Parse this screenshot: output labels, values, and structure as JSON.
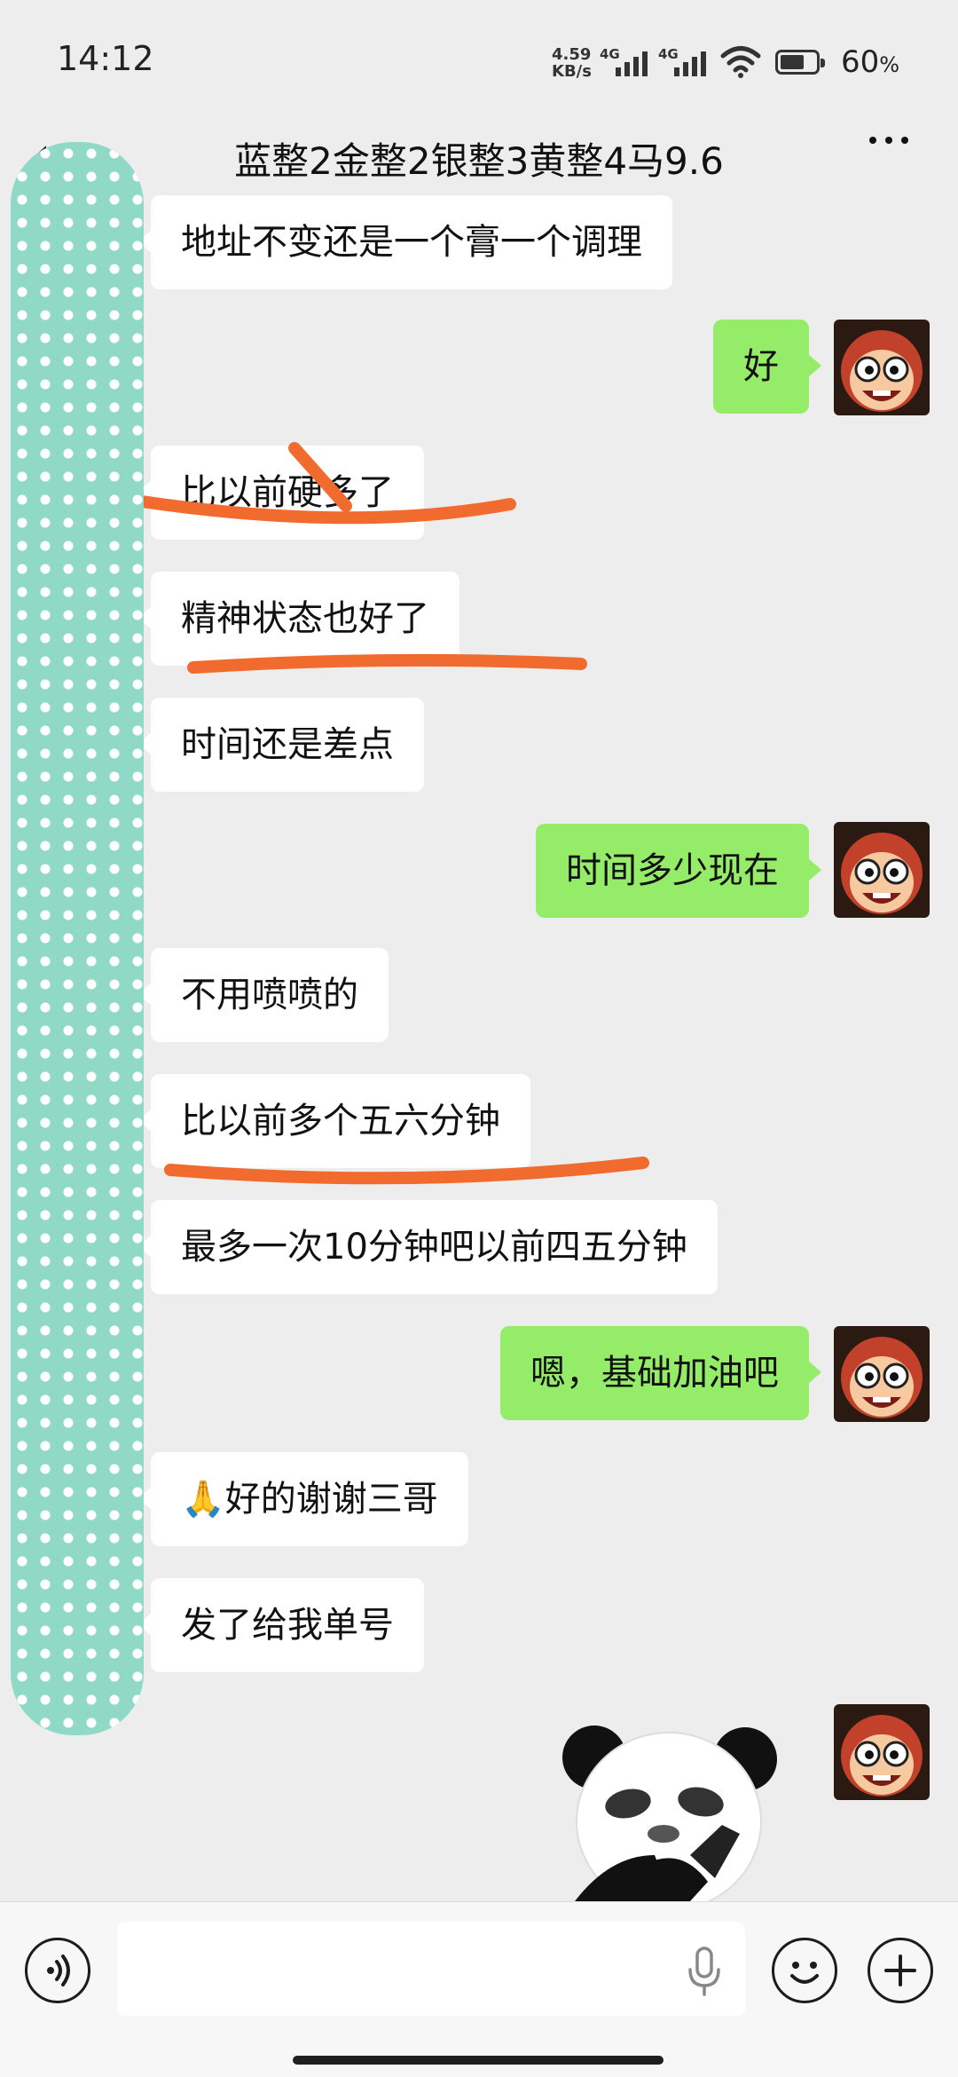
{
  "status_bar": {
    "time": "14:12",
    "net_speed_value": "4.59",
    "net_speed_unit": "KB/s",
    "signal1_label": "4G",
    "signal2_label": "4G",
    "battery_percent": "60",
    "battery_unit": "%"
  },
  "header": {
    "title": "蓝整2金整2银整3黄整4马9.6"
  },
  "messages": [
    {
      "direction": "in",
      "text": "地址不变还是一个膏一个调理"
    },
    {
      "direction": "out",
      "text": "好"
    },
    {
      "direction": "in",
      "text": "比以前硬多了"
    },
    {
      "direction": "in",
      "text": "精神状态也好了"
    },
    {
      "direction": "in",
      "text": "时间还是差点"
    },
    {
      "direction": "out",
      "text": "时间多少现在"
    },
    {
      "direction": "in",
      "text": "不用喷喷的"
    },
    {
      "direction": "in",
      "text": "比以前多个五六分钟"
    },
    {
      "direction": "in",
      "text": "最多一次10分钟吧以前四五分钟"
    },
    {
      "direction": "out",
      "text": "嗯，基础加油吧"
    },
    {
      "direction": "in",
      "text": "🙏好的谢谢三哥"
    },
    {
      "direction": "in",
      "text": "发了给我单号"
    },
    {
      "direction": "out",
      "type": "sticker",
      "text": ""
    }
  ],
  "input": {
    "value": "",
    "placeholder": ""
  },
  "colors": {
    "chat_background": "#ededed",
    "incoming_bubble": "#ffffff",
    "outgoing_bubble": "#95ec69",
    "annotation_stroke": "#f26b2e",
    "censor_fill": "#8fd9c6"
  },
  "icons": [
    "back-arrow-icon",
    "more-icon",
    "voice-icon",
    "microphone-icon",
    "emoji-icon",
    "plus-icon",
    "wifi-icon",
    "battery-icon",
    "signal-icon"
  ]
}
